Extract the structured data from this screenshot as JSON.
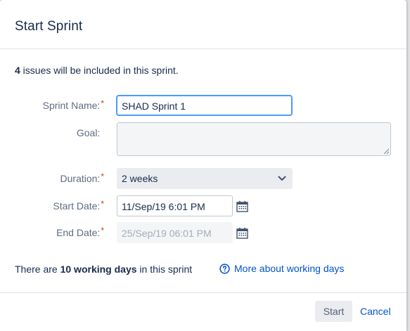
{
  "dialog": {
    "title": "Start Sprint",
    "summary_count": "4",
    "summary_text": " issues will be included in this sprint."
  },
  "form": {
    "sprint_name": {
      "label": "Sprint Name:",
      "required": "*",
      "value": "SHAD Sprint 1"
    },
    "goal": {
      "label": "Goal:",
      "value": ""
    },
    "duration": {
      "label": "Duration:",
      "required": "*",
      "value": "2 weeks"
    },
    "start_date": {
      "label": "Start Date:",
      "required": "*",
      "value": "11/Sep/19 6:01 PM"
    },
    "end_date": {
      "label": "End Date:",
      "required": "*",
      "value": "25/Sep/19 06:01 PM"
    }
  },
  "working_days": {
    "prefix": "There are ",
    "count": "10 working days",
    "suffix": " in this sprint",
    "link": "More about working days"
  },
  "footer": {
    "start_label": "Start",
    "cancel_label": "Cancel"
  },
  "icons": {
    "calendar": "calendar-icon",
    "help": "question-circle-icon",
    "chevron": "chevron-down-icon"
  },
  "colors": {
    "link": "#0052cc",
    "focus": "#4c9aff",
    "required": "#de350b"
  }
}
